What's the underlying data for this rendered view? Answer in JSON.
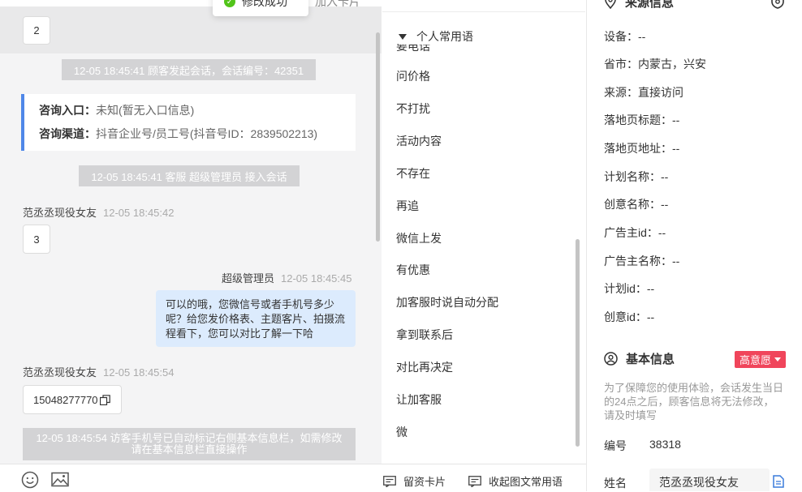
{
  "toast": {
    "text": "修改成功"
  },
  "peek_text": "加入卡片",
  "chat": {
    "customer_msg_1": "2",
    "sys_start": "12-05 18:45:41 顾客发起会话，会话编号：42351",
    "entry_label": "咨询入口：",
    "entry_value": "未知(暂无入口信息)",
    "channel_label": "咨询渠道：",
    "channel_value": "抖音企业号/员工号(抖音号ID：2839502213)",
    "sys_agent": "12-05 18:45:41 客服 超级管理员 接入会话",
    "customer_name": "范丞丞现役女友",
    "customer_time_1": "12-05 18:45:42",
    "customer_msg_2": "3",
    "agent_name": "超级管理员",
    "agent_time": "12-05 18:45:45",
    "agent_msg": "可以的哦，您微信号或者手机号多少呢？给您发价格表、主题客片、拍摄流程看下，您可以对比了解一下哈",
    "customer_time_2": "12-05 18:45:54",
    "customer_msg_3": "15048277770",
    "sys_phone": "12-05 18:45:54 访客手机号已自动标记右侧基本信息栏，如需修改请在基本信息栏直接操作"
  },
  "toolbar": {
    "card_btn": "留资卡片",
    "collapse_btn": "收起图文常用语"
  },
  "phrases": {
    "header": "个人常用语",
    "peek": "要电话",
    "items": [
      "问价格",
      "不打扰",
      "活动内容",
      "不存在",
      "再追",
      "微信上发",
      "有优惠",
      "加客服时说自动分配",
      "拿到联系后",
      "对比再决定",
      "让加客服",
      "微"
    ]
  },
  "source_info": {
    "title": "来源信息",
    "rows": [
      "设备：--",
      "省市：内蒙古，兴安",
      "来源：直接访问",
      "落地页标题：--",
      "落地页地址：--",
      "计划名称：--",
      "创意名称：--",
      "广告主id：--",
      "广告主名称：--",
      "计划id：--",
      "创意id：--"
    ]
  },
  "basic_info": {
    "title": "基本信息",
    "intent": "高意愿",
    "notice": "为了保障您的使用体验，会话发生当日的24点之后，顾客信息将无法修改，请及时填写",
    "id_label": "编号",
    "id_value": "38318",
    "name_label": "姓名",
    "name_value": "范丞丞现役女友"
  }
}
